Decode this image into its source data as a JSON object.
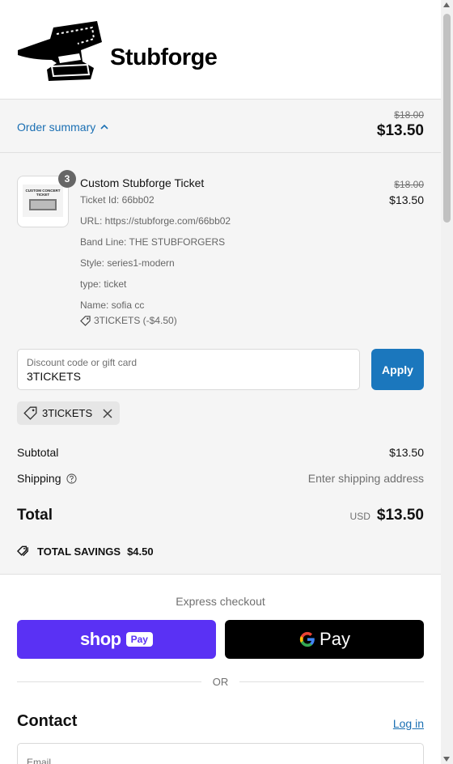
{
  "brand": {
    "name": "Stubforge"
  },
  "summary_bar": {
    "toggle_label": "Order summary",
    "original_total": "$18.00",
    "total": "$13.50"
  },
  "item": {
    "quantity": "3",
    "name": "Custom Stubforge Ticket",
    "thumb_text": "CUSTOM CONCERT TICKET",
    "properties": [
      "Ticket Id: 66bb02",
      "URL: https://stubforge.com/66bb02",
      "Band Line: THE STUBFORGERS",
      "Style: series1-modern",
      "type: ticket",
      "Name: sofia cc"
    ],
    "discount_label": "3TICKETS (-$4.50)",
    "original_price": "$18.00",
    "price": "$13.50"
  },
  "discount": {
    "label": "Discount code or gift card",
    "value": "3TICKETS",
    "apply_label": "Apply",
    "applied_code": "3TICKETS"
  },
  "totals": {
    "subtotal_label": "Subtotal",
    "subtotal": "$13.50",
    "shipping_label": "Shipping",
    "shipping_value": "Enter shipping address",
    "total_label": "Total",
    "currency": "USD",
    "total": "$13.50",
    "savings_label": "TOTAL SAVINGS",
    "savings": "$4.50"
  },
  "express": {
    "title": "Express checkout",
    "shop_word": "shop",
    "shop_pay_badge": "Pay",
    "gpay_word": "Pay",
    "or_label": "OR"
  },
  "contact": {
    "title": "Contact",
    "login_label": "Log in",
    "email_placeholder": "Email"
  },
  "colors": {
    "accent": "#1b77bd",
    "shop_pay": "#5a31f4",
    "summary_bg": "#f5f5f5"
  }
}
